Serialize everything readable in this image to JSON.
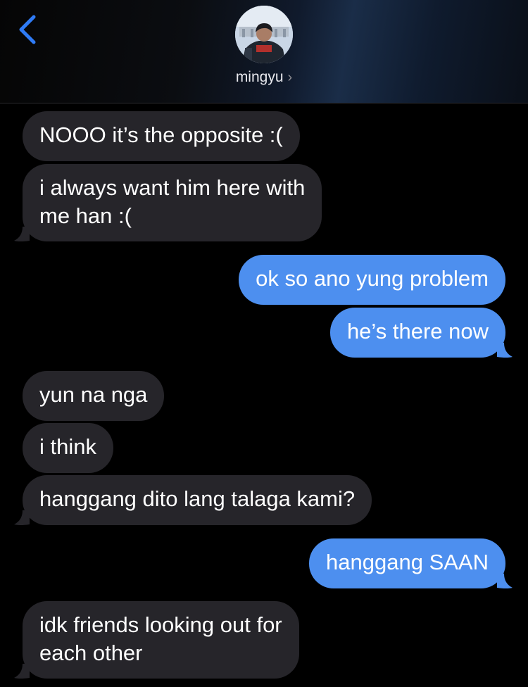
{
  "header": {
    "contact_name": "mingyu",
    "chevron": "›",
    "back_icon": "chevron-left-icon"
  },
  "colors": {
    "incoming_bubble": "#26252a",
    "outgoing_bubble": "#4d8fef",
    "back_accent": "#2f7bf5",
    "background": "#000000"
  },
  "messages": [
    {
      "side": "in",
      "text": "NOOO it’s the opposite :("
    },
    {
      "side": "in",
      "text": "i always want him here with\nme han :("
    },
    {
      "side": "out",
      "text": "ok so ano yung problem"
    },
    {
      "side": "out",
      "text": "he’s there now"
    },
    {
      "side": "in",
      "text": "yun na nga"
    },
    {
      "side": "in",
      "text": "i think"
    },
    {
      "side": "in",
      "text": "hanggang dito lang talaga kami?"
    },
    {
      "side": "out",
      "text": "hanggang SAAN"
    },
    {
      "side": "in",
      "text": "idk friends looking out for\neach other"
    }
  ]
}
